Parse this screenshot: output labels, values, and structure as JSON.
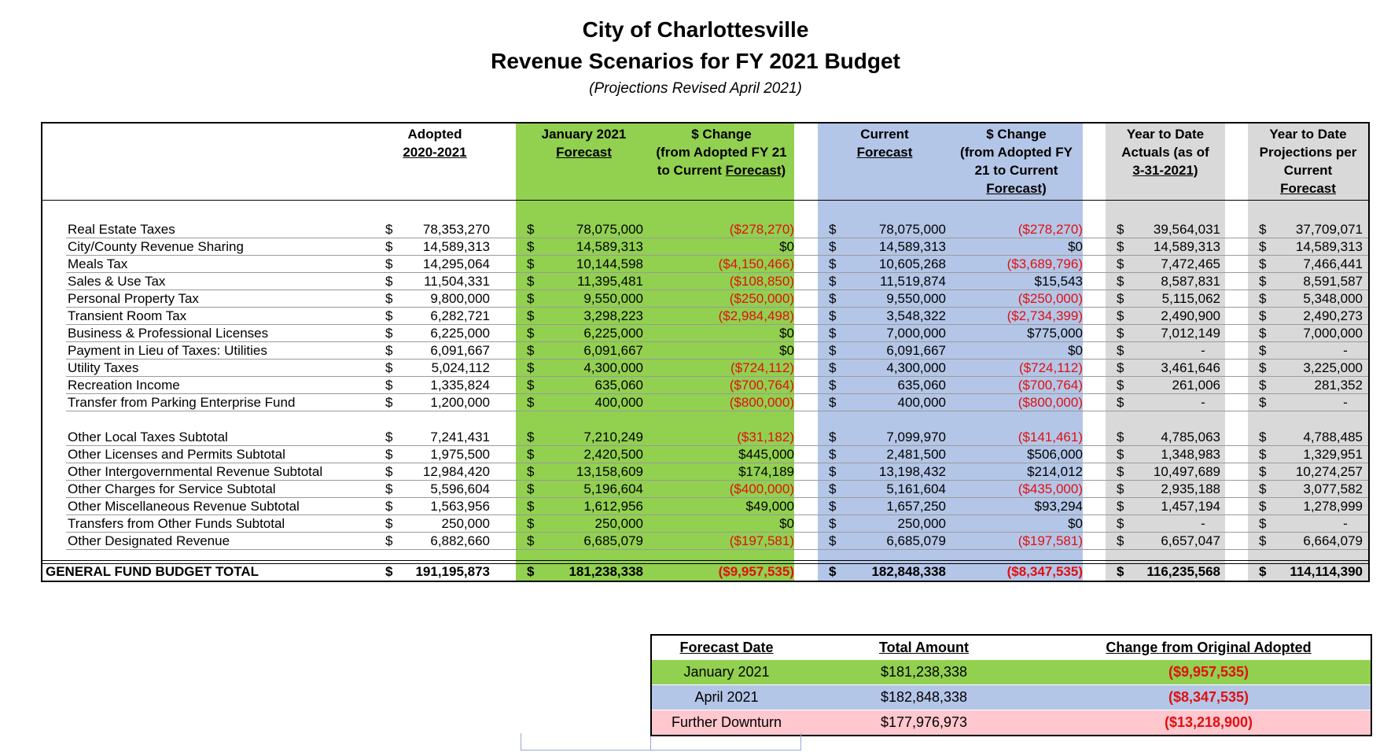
{
  "title": "City of Charlottesville",
  "subtitle": "Revenue Scenarios for FY 2021 Budget",
  "note": "(Projections Revised April 2021)",
  "headers": {
    "adopted": [
      "Adopted",
      "2020-2021"
    ],
    "jan": [
      "January 2021",
      "Forecast"
    ],
    "jan_change": [
      "$ Change",
      "(from Adopted FY 21",
      "to Current ",
      "Forecast)"
    ],
    "current": [
      "Current",
      "Forecast"
    ],
    "cur_change": [
      "$ Change",
      "(from Adopted FY",
      "21 to Current",
      "Forecast)"
    ],
    "ytd_actuals": [
      "Year to Date",
      "Actuals (as of",
      "3-31-2021)"
    ],
    "ytd_proj": [
      "Year to Date",
      "Projections per",
      "Current",
      "Forecast"
    ]
  },
  "currency_symbol": "$",
  "rows": [
    {
      "label": "Real Estate Taxes",
      "adopted": "78,353,270",
      "jan": "78,075,000",
      "jan_change": "($278,270)",
      "current": "78,075,000",
      "cur_change": "($278,270)",
      "ytd": "39,564,031",
      "proj": "37,709,071"
    },
    {
      "label": "City/County Revenue Sharing",
      "adopted": "14,589,313",
      "jan": "14,589,313",
      "jan_change": "$0",
      "current": "14,589,313",
      "cur_change": "$0",
      "ytd": "14,589,313",
      "proj": "14,589,313"
    },
    {
      "label": "Meals Tax",
      "adopted": "14,295,064",
      "jan": "10,144,598",
      "jan_change": "($4,150,466)",
      "current": "10,605,268",
      "cur_change": "($3,689,796)",
      "ytd": "7,472,465",
      "proj": "7,466,441"
    },
    {
      "label": "Sales & Use Tax",
      "adopted": "11,504,331",
      "jan": "11,395,481",
      "jan_change": "($108,850)",
      "current": "11,519,874",
      "cur_change": "$15,543",
      "ytd": "8,587,831",
      "proj": "8,591,587"
    },
    {
      "label": "Personal Property Tax",
      "adopted": "9,800,000",
      "jan": "9,550,000",
      "jan_change": "($250,000)",
      "current": "9,550,000",
      "cur_change": "($250,000)",
      "ytd": "5,115,062",
      "proj": "5,348,000"
    },
    {
      "label": "Transient Room Tax",
      "adopted": "6,282,721",
      "jan": "3,298,223",
      "jan_change": "($2,984,498)",
      "current": "3,548,322",
      "cur_change": "($2,734,399)",
      "ytd": "2,490,900",
      "proj": "2,490,273"
    },
    {
      "label": "Business & Professional Licenses",
      "adopted": "6,225,000",
      "jan": "6,225,000",
      "jan_change": "$0",
      "current": "7,000,000",
      "cur_change": "$775,000",
      "ytd": "7,012,149",
      "proj": "7,000,000"
    },
    {
      "label": "Payment in Lieu of Taxes:  Utilities",
      "adopted": "6,091,667",
      "jan": "6,091,667",
      "jan_change": "$0",
      "current": "6,091,667",
      "cur_change": "$0",
      "ytd": "-",
      "proj": "-"
    },
    {
      "label": "Utility Taxes",
      "adopted": "5,024,112",
      "jan": "4,300,000",
      "jan_change": "($724,112)",
      "current": "4,300,000",
      "cur_change": "($724,112)",
      "ytd": "3,461,646",
      "proj": "3,225,000"
    },
    {
      "label": "Recreation Income",
      "adopted": "1,335,824",
      "jan": "635,060",
      "jan_change": "($700,764)",
      "current": "635,060",
      "cur_change": "($700,764)",
      "ytd": "261,006",
      "proj": "281,352"
    },
    {
      "label": "Transfer from Parking Enterprise Fund",
      "adopted": "1,200,000",
      "jan": "400,000",
      "jan_change": "($800,000)",
      "current": "400,000",
      "cur_change": "($800,000)",
      "ytd": "-",
      "proj": "-"
    },
    {
      "label": "Other Local Taxes Subtotal",
      "adopted": "7,241,431",
      "jan": "7,210,249",
      "jan_change": "($31,182)",
      "current": "7,099,970",
      "cur_change": "($141,461)",
      "ytd": "4,785,063",
      "proj": "4,788,485"
    },
    {
      "label": "Other Licenses and Permits Subtotal",
      "adopted": "1,975,500",
      "jan": "2,420,500",
      "jan_change": "$445,000",
      "current": "2,481,500",
      "cur_change": "$506,000",
      "ytd": "1,348,983",
      "proj": "1,329,951"
    },
    {
      "label": "Other Intergovernmental Revenue Subtotal",
      "adopted": "12,984,420",
      "jan": "13,158,609",
      "jan_change": "$174,189",
      "current": "13,198,432",
      "cur_change": "$214,012",
      "ytd": "10,497,689",
      "proj": "10,274,257"
    },
    {
      "label": "Other Charges for Service Subtotal",
      "adopted": "5,596,604",
      "jan": "5,196,604",
      "jan_change": "($400,000)",
      "current": "5,161,604",
      "cur_change": "($435,000)",
      "ytd": "2,935,188",
      "proj": "3,077,582"
    },
    {
      "label": "Other Miscellaneous Revenue Subtotal",
      "adopted": "1,563,956",
      "jan": "1,612,956",
      "jan_change": "$49,000",
      "current": "1,657,250",
      "cur_change": "$93,294",
      "ytd": "1,457,194",
      "proj": "1,278,999"
    },
    {
      "label": "Transfers from Other Funds Subtotal",
      "adopted": "250,000",
      "jan": "250,000",
      "jan_change": "$0",
      "current": "250,000",
      "cur_change": "$0",
      "ytd": "-",
      "proj": "-"
    },
    {
      "label": "Other Designated Revenue",
      "adopted": "6,882,660",
      "jan": "6,685,079",
      "jan_change": "($197,581)",
      "current": "6,685,079",
      "cur_change": "($197,581)",
      "ytd": "6,657,047",
      "proj": "6,664,079"
    }
  ],
  "total": {
    "label": "GENERAL FUND BUDGET TOTAL",
    "adopted": "191,195,873",
    "jan": "181,238,338",
    "jan_change": "($9,957,535)",
    "current": "182,848,338",
    "cur_change": "($8,347,535)",
    "ytd": "116,235,568",
    "proj": "114,114,390"
  },
  "summary": {
    "headers": [
      "Forecast Date",
      "Total Amount",
      "Change from Original Adopted"
    ],
    "rows": [
      {
        "date": "January 2021",
        "amount": "$181,238,338",
        "change": "($9,957,535)",
        "color": "#92d050"
      },
      {
        "date": "April 2021",
        "amount": "$182,848,338",
        "change": "($8,347,535)",
        "color": "#b4c6e7"
      },
      {
        "date": "Further Downturn",
        "amount": "$177,976,973",
        "change": "($13,218,900)",
        "color": "#ffc7ce"
      }
    ]
  },
  "colors": {
    "green": "#92d050",
    "blue": "#b4c6e7",
    "gray": "#d9d9d9",
    "negative": "#e01010",
    "pink": "#ffc7ce"
  }
}
